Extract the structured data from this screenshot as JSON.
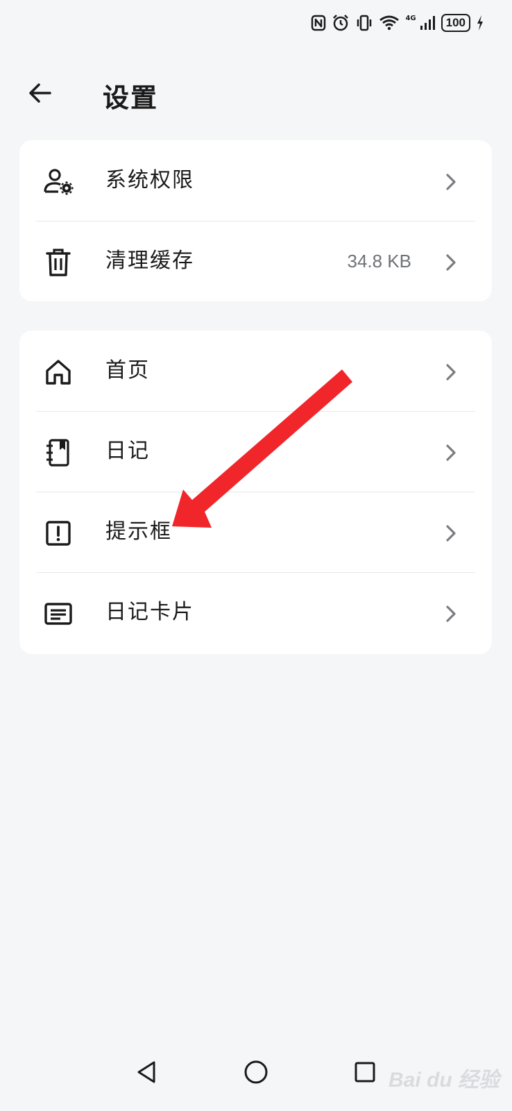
{
  "status_bar": {
    "signal_label": "4G",
    "battery": "100"
  },
  "header": {
    "title": "设置"
  },
  "card_system": {
    "items": [
      {
        "label": "系统权限",
        "icon": "user-settings-icon"
      },
      {
        "label": "清理缓存",
        "value": "34.8 KB",
        "icon": "trash-icon"
      }
    ]
  },
  "card_features": {
    "items": [
      {
        "label": "首页",
        "icon": "home-icon"
      },
      {
        "label": "日记",
        "icon": "notebook-icon"
      },
      {
        "label": "提示框",
        "icon": "alert-box-icon"
      },
      {
        "label": "日记卡片",
        "icon": "card-icon"
      }
    ]
  },
  "annotation": {
    "arrow_color": "#f0262b"
  },
  "watermark": {
    "text": "Bai du 经验"
  },
  "colors": {
    "background": "#f5f6f8",
    "card": "#ffffff",
    "text": "#1a1a1a",
    "secondary_text": "#6f7175",
    "chevron": "#7a7c80"
  }
}
